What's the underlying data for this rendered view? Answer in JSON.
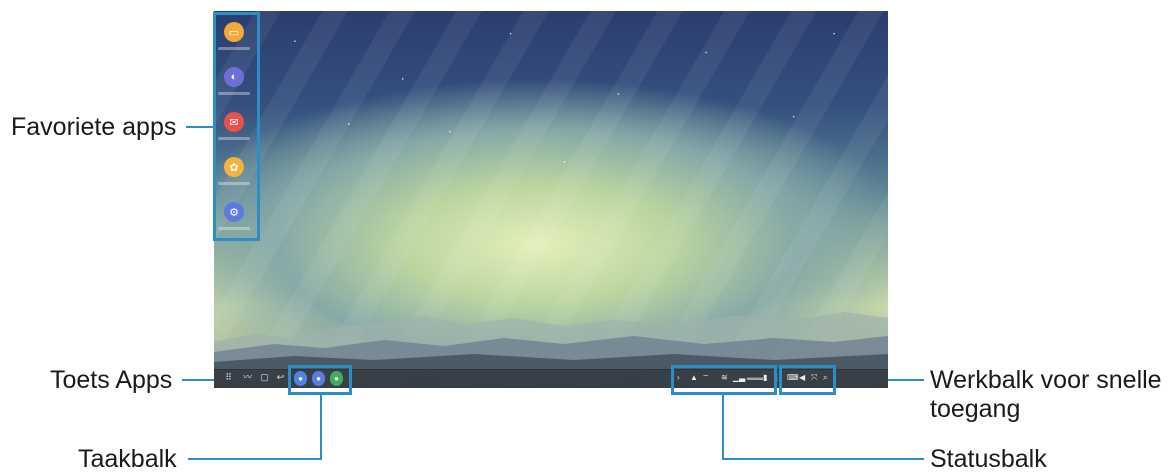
{
  "callouts": {
    "favorite_apps": "Favoriete apps",
    "apps_key": "Toets Apps",
    "taskbar": "Taakbalk",
    "quick_access_line1": "Werkbalk voor snelle",
    "quick_access_line2": "toegang",
    "statusbar": "Statusbalk"
  },
  "dock": [
    {
      "icon": "my-files-icon",
      "color": "#f2a93b",
      "glyph": "▭"
    },
    {
      "icon": "internet-icon",
      "color": "#6d6fd8",
      "glyph": "◐"
    },
    {
      "icon": "email-icon",
      "color": "#e9524a",
      "glyph": "✉"
    },
    {
      "icon": "gallery-icon",
      "color": "#f4b33c",
      "glyph": "✿"
    },
    {
      "icon": "settings-icon",
      "color": "#5b7be0",
      "glyph": "⚙"
    }
  ],
  "taskbar_apps": [
    {
      "icon": "taskbar-app-1-icon",
      "color": "#4f86e3"
    },
    {
      "icon": "taskbar-app-2-icon",
      "color": "#5b7be0"
    },
    {
      "icon": "taskbar-app-3-icon",
      "color": "#3fae5a"
    }
  ],
  "colors": {
    "accent": "#2a8fc9"
  }
}
